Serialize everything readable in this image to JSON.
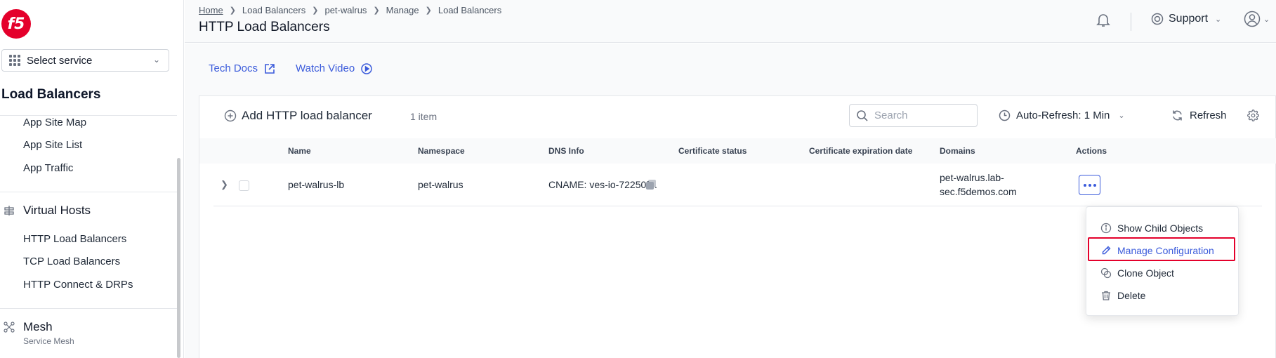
{
  "sidebar": {
    "logo_text": "f5",
    "select_service": "Select service",
    "section_title": "Load Balancers",
    "items_top": [
      "App Site Map",
      "App Site List",
      "App Traffic"
    ],
    "group_virtual_hosts": {
      "label": "Virtual Hosts",
      "items": [
        "HTTP Load Balancers",
        "TCP Load Balancers",
        "HTTP Connect & DRPs"
      ]
    },
    "group_mesh": {
      "label": "Mesh",
      "sublabel": "Service Mesh"
    }
  },
  "header": {
    "breadcrumb": [
      "Home",
      "Load Balancers",
      "pet-walrus",
      "Manage",
      "Load Balancers"
    ],
    "title": "HTTP Load Balancers",
    "support_label": "Support"
  },
  "links": {
    "tech_docs": "Tech Docs",
    "watch_video": "Watch Video"
  },
  "toolbar": {
    "add_label": "Add HTTP load balancer",
    "item_count": "1 item",
    "search_placeholder": "Search",
    "auto_refresh": "Auto-Refresh: 1 Min",
    "refresh": "Refresh"
  },
  "table": {
    "columns": [
      "Name",
      "Namespace",
      "DNS Info",
      "Certificate status",
      "Certificate expiration date",
      "Domains",
      "Actions"
    ],
    "rows": [
      {
        "name": "pet-walrus-lb",
        "namespace": "pet-walrus",
        "dns_info": "CNAME: ves-io-72250f...",
        "certificate_status": "",
        "certificate_expiration": "",
        "domains_line1": "pet-walrus.lab-",
        "domains_line2": "sec.f5demos.com"
      }
    ]
  },
  "actions_menu": {
    "items": [
      "Show Child Objects",
      "Manage Configuration",
      "Clone Object",
      "Delete"
    ],
    "highlighted": "Manage Configuration"
  },
  "colors": {
    "accent": "#3b5bdb",
    "brand": "#e4002b",
    "highlight_border": "#e4002b"
  }
}
